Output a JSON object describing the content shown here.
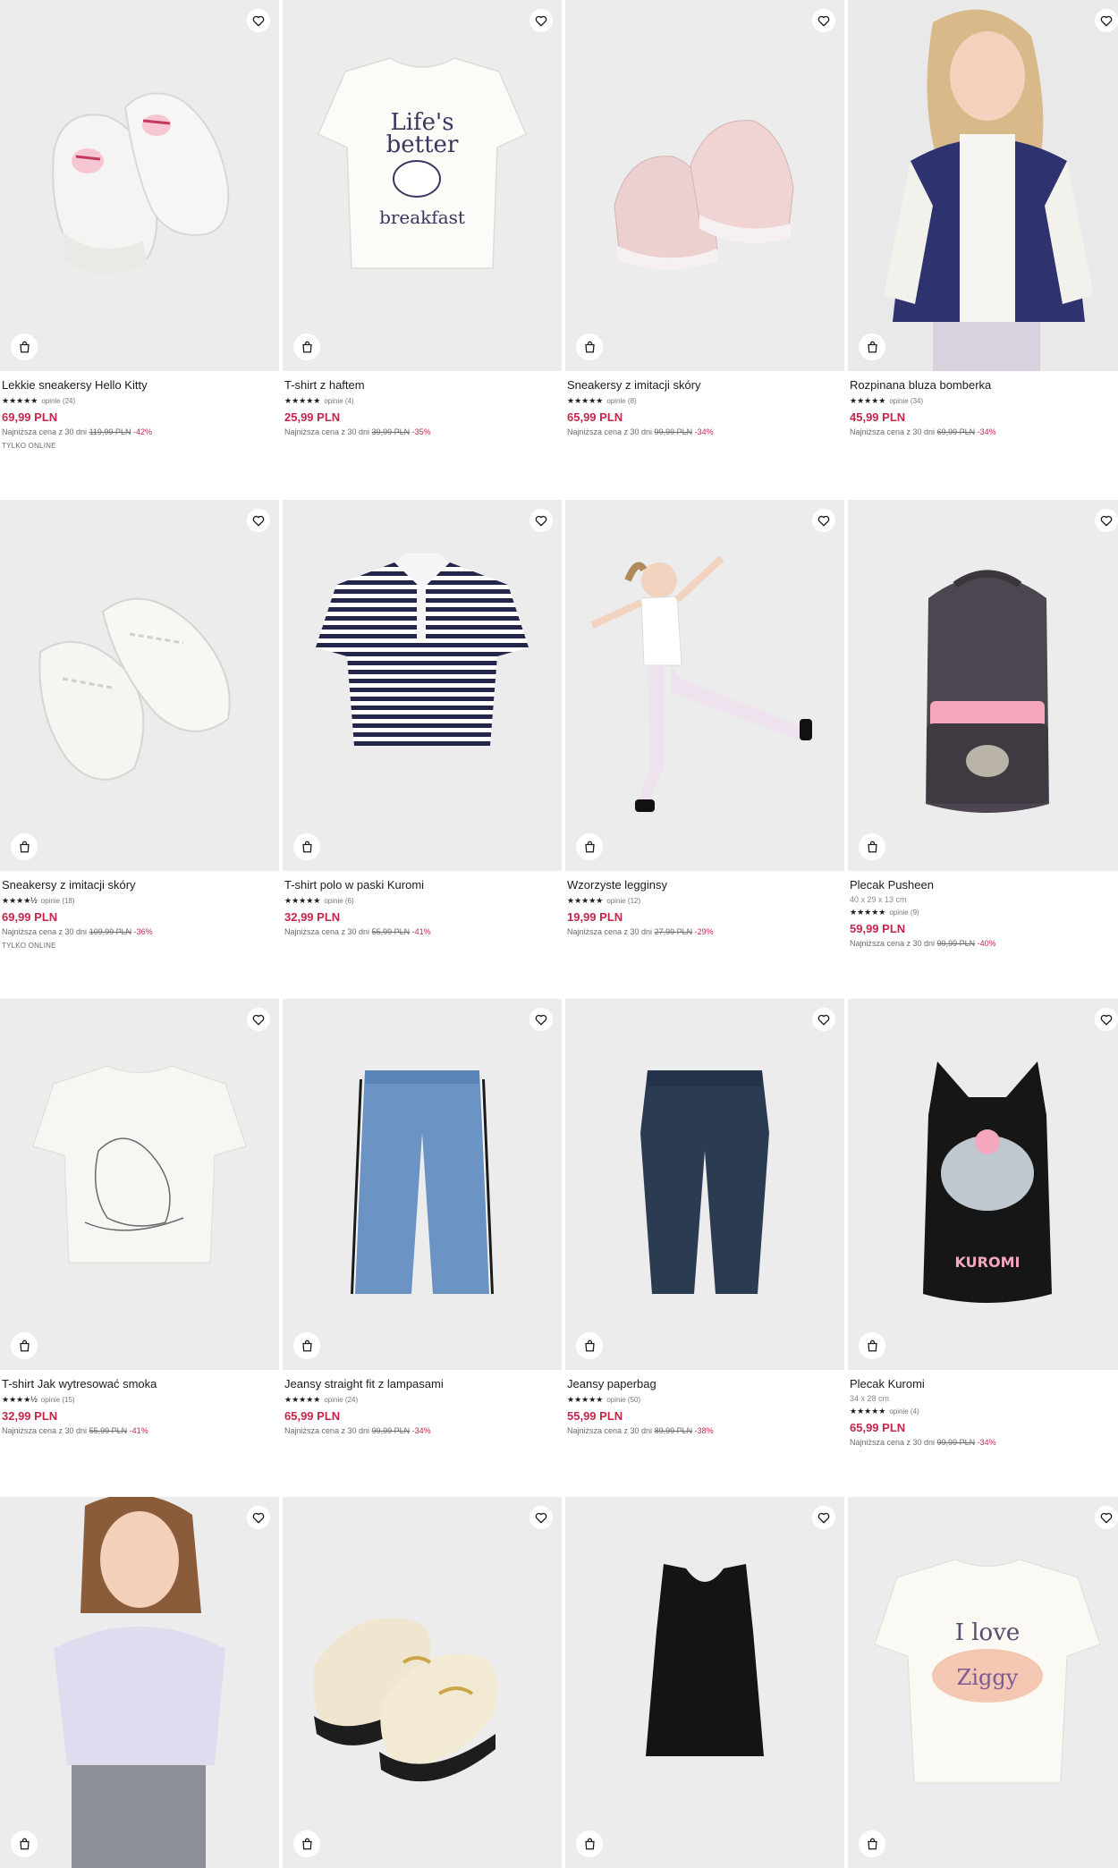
{
  "labels": {
    "lowest_price_prefix": "Najniższa cena z 30 dni",
    "reviews_word": "opinie"
  },
  "colors": {
    "sale": "#c4274b",
    "image_bg": "#ececed"
  },
  "icons": {
    "wishlist": "heart-icon",
    "cart": "shopping-bag-icon",
    "rating": "star-icon"
  },
  "products": [
    {
      "name": "Lekkie sneakersy Hello Kitty",
      "dims": "",
      "stars": "★★★★★",
      "reviews": "opinie (24)",
      "price": "69,99 PLN",
      "lowest_prefix": "Najniższa cena z 30 dni",
      "old_price": "119,99 PLN",
      "discount": "-42%",
      "badge": "TYLKO ONLINE",
      "art": "sneakers-kitty"
    },
    {
      "name": "T-shirt z haftem",
      "dims": "",
      "stars": "★★★★★",
      "reviews": "opinie (4)",
      "price": "25,99 PLN",
      "lowest_prefix": "Najniższa cena z 30 dni",
      "old_price": "39,99 PLN",
      "discount": "-35%",
      "badge": "",
      "art": "tshirt-print"
    },
    {
      "name": "Sneakersy z imitacji skóry",
      "dims": "",
      "stars": "★★★★★",
      "reviews": "opinie (8)",
      "price": "65,99 PLN",
      "lowest_prefix": "Najniższa cena z 30 dni",
      "old_price": "99,99 PLN",
      "discount": "-34%",
      "badge": "",
      "art": "sneakers-pink"
    },
    {
      "name": "Rozpinana bluza bomberka",
      "dims": "",
      "stars": "★★★★★",
      "reviews": "opinie (34)",
      "price": "45,99 PLN",
      "lowest_prefix": "Najniższa cena z 30 dni",
      "old_price": "69,99 PLN",
      "discount": "-34%",
      "badge": "",
      "art": "girl-bomber"
    },
    {
      "name": "Sneakersy z imitacji skóry",
      "dims": "",
      "stars": "★★★★½",
      "reviews": "opinie (18)",
      "price": "69,99 PLN",
      "lowest_prefix": "Najniższa cena z 30 dni",
      "old_price": "109,99 PLN",
      "discount": "-36%",
      "badge": "TYLKO ONLINE",
      "art": "sneakers-white"
    },
    {
      "name": "T-shirt polo w paski Kuromi",
      "dims": "",
      "stars": "★★★★★",
      "reviews": "opinie (6)",
      "price": "32,99 PLN",
      "lowest_prefix": "Najniższa cena z 30 dni",
      "old_price": "55,99 PLN",
      "discount": "-41%",
      "badge": "",
      "art": "polo-stripes"
    },
    {
      "name": "Wzorzyste legginsy",
      "dims": "",
      "stars": "★★★★★",
      "reviews": "opinie (12)",
      "price": "19,99 PLN",
      "lowest_prefix": "Najniższa cena z 30 dni",
      "old_price": "27,99 PLN",
      "discount": "-29%",
      "badge": "",
      "art": "girl-leggings"
    },
    {
      "name": "Plecak Pusheen",
      "dims": "40 x 29 x 13 cm",
      "stars": "★★★★★",
      "reviews": "opinie (9)",
      "price": "59,99 PLN",
      "lowest_prefix": "Najniższa cena z 30 dni",
      "old_price": "99,99 PLN",
      "discount": "-40%",
      "badge": "",
      "art": "backpack-pusheen"
    },
    {
      "name": "T-shirt Jak wytresować smoka",
      "dims": "",
      "stars": "★★★★½",
      "reviews": "opinie (15)",
      "price": "32,99 PLN",
      "lowest_prefix": "Najniższa cena z 30 dni",
      "old_price": "55,99 PLN",
      "discount": "-41%",
      "badge": "",
      "art": "tshirt-dragon"
    },
    {
      "name": "Jeansy straight fit z lampasami",
      "dims": "",
      "stars": "★★★★★",
      "reviews": "opinie (24)",
      "price": "65,99 PLN",
      "lowest_prefix": "Najniższa cena z 30 dni",
      "old_price": "99,99 PLN",
      "discount": "-34%",
      "badge": "",
      "art": "jeans-light"
    },
    {
      "name": "Jeansy paperbag",
      "dims": "",
      "stars": "★★★★★",
      "reviews": "opinie (50)",
      "price": "55,99 PLN",
      "lowest_prefix": "Najniższa cena z 30 dni",
      "old_price": "89,99 PLN",
      "discount": "-38%",
      "badge": "",
      "art": "jeans-dark"
    },
    {
      "name": "Plecak Kuromi",
      "dims": "34 x 28 cm",
      "stars": "★★★★★",
      "reviews": "opinie (4)",
      "price": "65,99 PLN",
      "lowest_prefix": "Najniższa cena z 30 dni",
      "old_price": "99,99 PLN",
      "discount": "-34%",
      "badge": "",
      "art": "backpack-kuromi"
    },
    {
      "name": "",
      "dims": "",
      "stars": "",
      "reviews": "",
      "price": "",
      "lowest_prefix": "",
      "old_price": "",
      "discount": "",
      "badge": "",
      "art": "girl-tee"
    },
    {
      "name": "",
      "dims": "",
      "stars": "",
      "reviews": "",
      "price": "",
      "lowest_prefix": "",
      "old_price": "",
      "discount": "",
      "badge": "",
      "art": "loafers"
    },
    {
      "name": "",
      "dims": "",
      "stars": "",
      "reviews": "",
      "price": "",
      "lowest_prefix": "",
      "old_price": "",
      "discount": "",
      "badge": "",
      "art": "tank-top"
    },
    {
      "name": "",
      "dims": "",
      "stars": "",
      "reviews": "",
      "price": "",
      "lowest_prefix": "",
      "old_price": "",
      "discount": "",
      "badge": "",
      "art": "tshirt-love"
    }
  ]
}
